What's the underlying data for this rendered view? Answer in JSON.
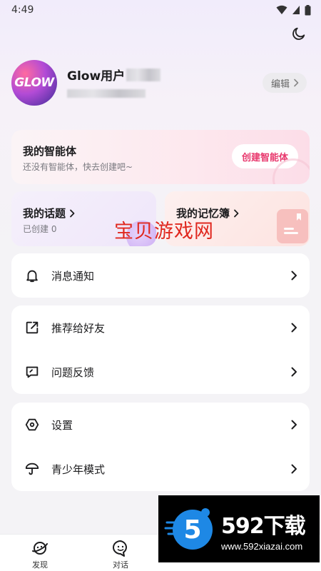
{
  "status_bar": {
    "time": "4:49"
  },
  "profile": {
    "avatar_text": "GLOW",
    "username": "Glow用户",
    "edit_label": "编辑"
  },
  "agent_card": {
    "title": "我的智能体",
    "subtitle": "还没有智能体，快去创建吧~",
    "create_label": "创建智能体"
  },
  "topics_card": {
    "title": "我的话题",
    "subtitle": "已创建 0"
  },
  "memory_card": {
    "title": "我的记忆簿"
  },
  "watermark": "宝贝游戏网",
  "menu_groups": {
    "notifications": {
      "label": "消息通知",
      "icon": "bell-icon"
    },
    "recommend": {
      "label": "推荐给好友",
      "icon": "share-icon"
    },
    "feedback": {
      "label": "问题反馈",
      "icon": "feedback-icon"
    },
    "settings": {
      "label": "设置",
      "icon": "settings-icon"
    },
    "youth_mode": {
      "label": "青少年模式",
      "icon": "umbrella-icon"
    }
  },
  "bottom_nav": {
    "discover": "发现",
    "chat": "对话"
  },
  "brand_banner": {
    "logo_number": "5",
    "name": "592下载",
    "url": "www.592xiazai.com"
  },
  "colors": {
    "accent_pink": "#e8386d",
    "watermark_red": "#e0281f",
    "background": "#f4f3f6"
  }
}
